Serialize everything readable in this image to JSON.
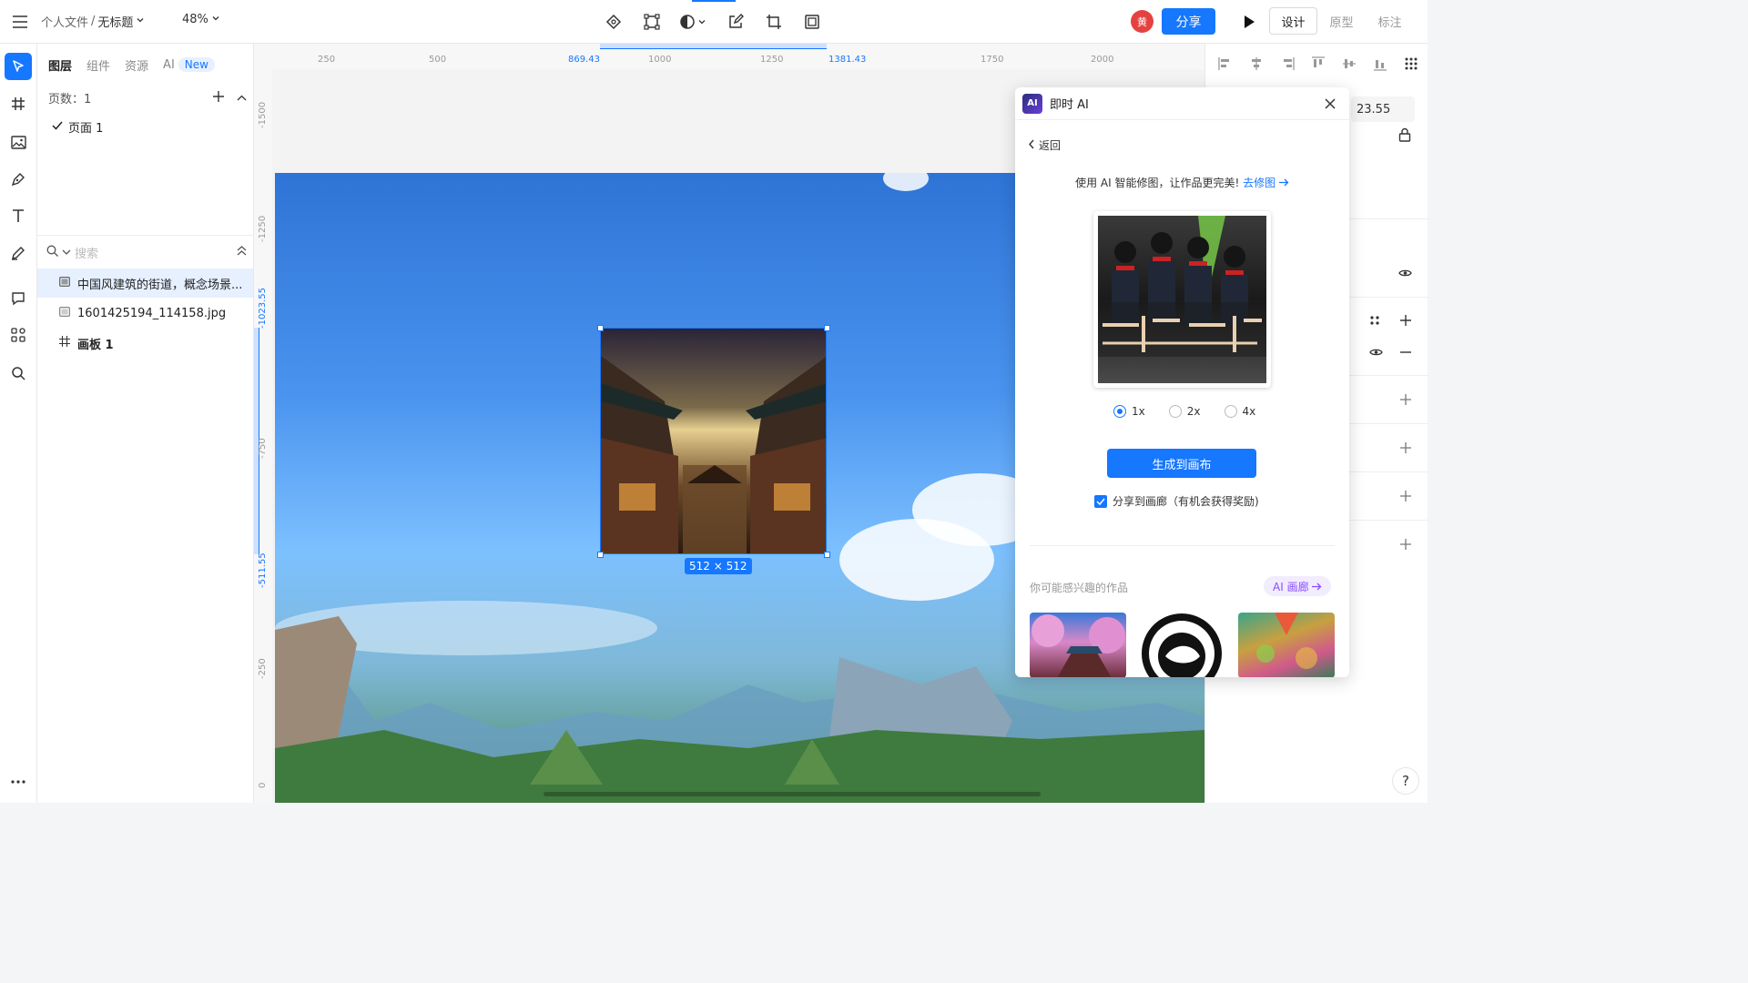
{
  "topbar": {
    "breadcrumb_folder": "个人文件",
    "breadcrumb_sep": "/",
    "file_name": "无标题",
    "zoom": "48%",
    "user_avatar": "黄",
    "share_label": "分享",
    "modes": [
      "设计",
      "原型",
      "标注"
    ],
    "active_mode": "设计"
  },
  "left_panel": {
    "tabs": [
      "图层",
      "组件",
      "资源",
      "AI"
    ],
    "new_badge": "New",
    "pages_label": "页数：1",
    "page_name": "页面 1",
    "search_placeholder": "搜索",
    "layers": [
      {
        "name": "中国风建筑的街道，概念场景...",
        "type": "image",
        "selected": true
      },
      {
        "name": "1601425194_114158.jpg",
        "type": "image",
        "selected": false
      },
      {
        "name": "画板 1",
        "type": "frame",
        "selected": false
      }
    ]
  },
  "canvas": {
    "ruler_top": [
      "250",
      "500",
      "869.43",
      "1000",
      "1250",
      "1381.43",
      "1750",
      "2000"
    ],
    "ruler_left": [
      "-1500",
      "-1250",
      "-1023.55",
      "-750",
      "-511.55",
      "-250",
      "0"
    ],
    "selection_size": "512 × 512"
  },
  "right_panel": {
    "field_value": "23.55"
  },
  "ai_dialog": {
    "title": "即时 AI",
    "logo_text": "AI",
    "back_label": "返回",
    "promo_text": "使用 AI 智能修图，让作品更完美!",
    "promo_link": "去修图",
    "scales": [
      "1x",
      "2x",
      "4x"
    ],
    "selected_scale": "1x",
    "generate_label": "生成到画布",
    "share_checkbox_label": "分享到画廊（有机会获得奖励)",
    "interest_label": "你可能感兴趣的作品",
    "gallery_label": "AI 画廊"
  },
  "colors": {
    "accent": "#1677ff",
    "avatar": "#e64141",
    "gallery_purple": "#8a4dff"
  }
}
